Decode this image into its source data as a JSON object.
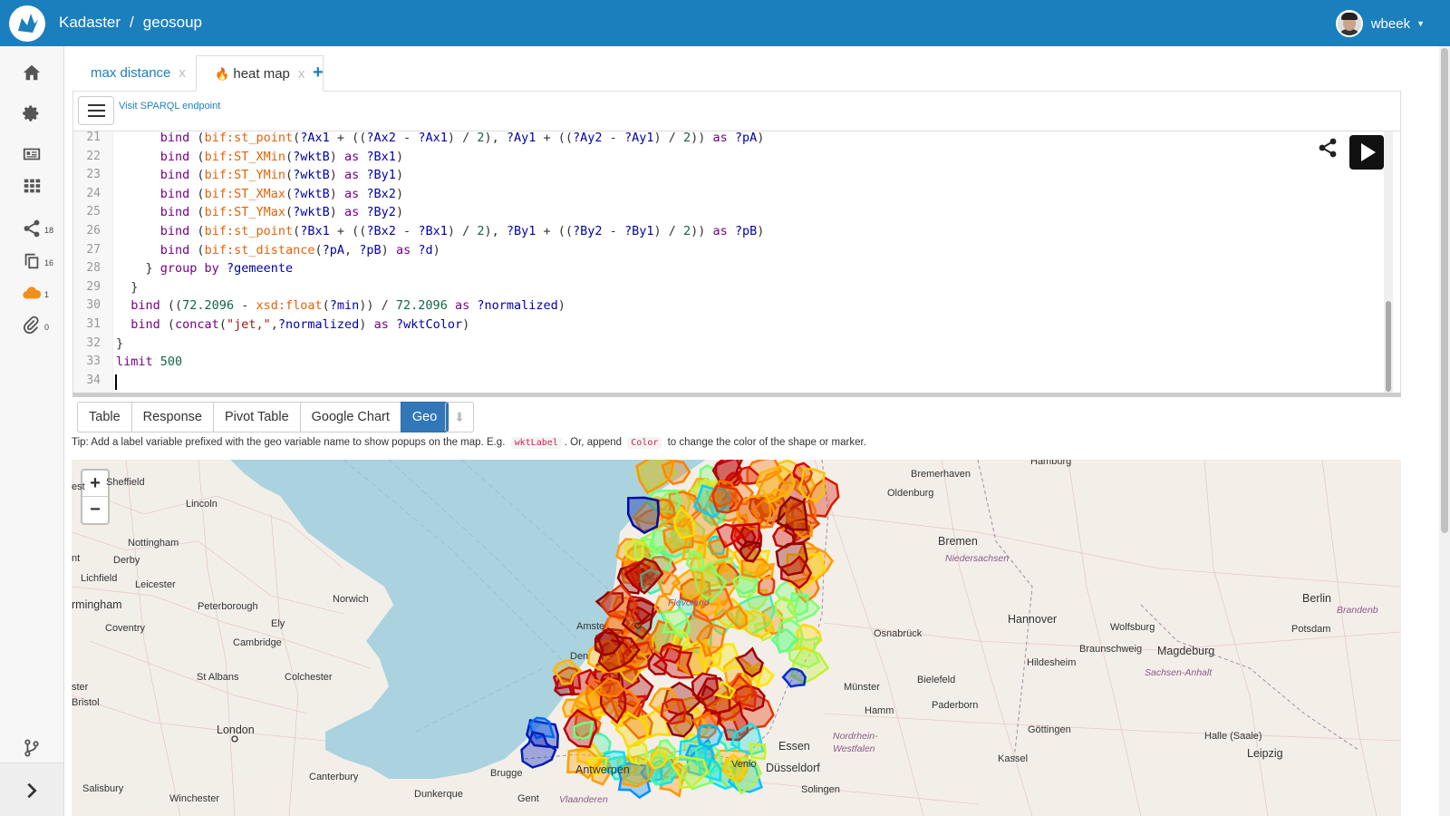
{
  "header": {
    "org": "Kadaster",
    "separator": "/",
    "dataset": "geosoup",
    "user": "wbeek",
    "brand_color": "#1c7fbd"
  },
  "sidebar": {
    "items": [
      {
        "icon": "home-icon"
      },
      {
        "icon": "gear-icon"
      },
      {
        "icon": "id-card-icon"
      },
      {
        "icon": "grid-icon"
      },
      {
        "icon": "share-icon",
        "count": "18"
      },
      {
        "icon": "copy-icon",
        "count": "16"
      },
      {
        "icon": "cloud-icon",
        "count": "1"
      },
      {
        "icon": "paperclip-icon",
        "count": "0"
      },
      {
        "icon": "branch-icon"
      }
    ],
    "expand_icon": "chevron-right-icon"
  },
  "tabs": [
    {
      "label": "max distance",
      "close": "x"
    },
    {
      "label": "heat map",
      "close": "x",
      "active": true
    }
  ],
  "editor": {
    "endpoint_link": "Visit SPARQL endpoint",
    "lines": [
      {
        "n": "21",
        "html": "      <span class='kw'>bind</span> (<span class='fn'>bif:st_point</span>(<span class='var'>?Ax1</span> + ((<span class='var'>?Ax2</span> - <span class='var'>?Ax1</span>) / <span class='num'>2</span>), <span class='var'>?Ay1</span> + ((<span class='var'>?Ay2</span> - <span class='var'>?Ay1</span>) / <span class='num'>2</span>)) <span class='kw'>as</span> <span class='var'>?pA</span>)"
      },
      {
        "n": "22",
        "html": "      <span class='kw'>bind</span> (<span class='fn'>bif:ST_XMin</span>(<span class='var'>?wktB</span>) <span class='kw'>as</span> <span class='var'>?Bx1</span>)"
      },
      {
        "n": "23",
        "html": "      <span class='kw'>bind</span> (<span class='fn'>bif:ST_YMin</span>(<span class='var'>?wktB</span>) <span class='kw'>as</span> <span class='var'>?By1</span>)"
      },
      {
        "n": "24",
        "html": "      <span class='kw'>bind</span> (<span class='fn'>bif:ST_XMax</span>(<span class='var'>?wktB</span>) <span class='kw'>as</span> <span class='var'>?Bx2</span>)"
      },
      {
        "n": "25",
        "html": "      <span class='kw'>bind</span> (<span class='fn'>bif:ST_YMax</span>(<span class='var'>?wktB</span>) <span class='kw'>as</span> <span class='var'>?By2</span>)"
      },
      {
        "n": "26",
        "html": "      <span class='kw'>bind</span> (<span class='fn'>bif:st_point</span>(<span class='var'>?Bx1</span> + ((<span class='var'>?Bx2</span> - <span class='var'>?Bx1</span>) / <span class='num'>2</span>), <span class='var'>?By1</span> + ((<span class='var'>?By2</span> - <span class='var'>?By1</span>) / <span class='num'>2</span>)) <span class='kw'>as</span> <span class='var'>?pB</span>)"
      },
      {
        "n": "27",
        "html": "      <span class='kw'>bind</span> (<span class='fn'>bif:st_distance</span>(<span class='var'>?pA</span>, <span class='var'>?pB</span>) <span class='kw'>as</span> <span class='var'>?d</span>)"
      },
      {
        "n": "28",
        "html": "    } <span class='kw'>group by</span> <span class='var'>?gemeente</span>"
      },
      {
        "n": "29",
        "html": "  }"
      },
      {
        "n": "30",
        "html": "  <span class='kw'>bind</span> ((<span class='num'>72.2096</span> - <span class='fn'>xsd:float</span>(<span class='var'>?min</span>)) / <span class='num'>72.2096</span> <span class='kw'>as</span> <span class='var'>?normalized</span>)"
      },
      {
        "n": "31",
        "html": "  <span class='kw'>bind</span> (<span class='kw'>concat</span>(<span class='str'>\"jet,\"</span>,<span class='var'>?normalized</span>) <span class='kw'>as</span> <span class='var'>?wktColor</span>)"
      },
      {
        "n": "32",
        "html": "}"
      },
      {
        "n": "33",
        "html": "<span class='kw'>limit</span> <span class='num'>500</span>"
      },
      {
        "n": "34",
        "html": ""
      }
    ]
  },
  "results": {
    "tabs": [
      "Table",
      "Response",
      "Pivot Table",
      "Google Chart",
      "Geo"
    ],
    "active": "Geo",
    "download_icon": "download-icon",
    "tip_prefix": "Tip: Add a label variable prefixed with the geo variable name to show popups on the map. E.g.",
    "tip_code1": "wktLabel",
    "tip_mid": ". Or, append",
    "tip_code2": "Color",
    "tip_suffix": "to change the color of the shape or marker."
  },
  "map": {
    "zoom_in": "+",
    "zoom_out": "−",
    "places": [
      {
        "name": "Sheffield",
        "l": 38,
        "t": 19
      },
      {
        "name": "est",
        "l": 0,
        "t": 24
      },
      {
        "name": "Lincoln",
        "l": 126,
        "t": 43
      },
      {
        "name": "Nottingham",
        "l": 62,
        "t": 86
      },
      {
        "name": "Derby",
        "l": 46,
        "t": 105
      },
      {
        "name": "nt",
        "l": 0,
        "t": 103
      },
      {
        "name": "Lichfield",
        "l": 10,
        "t": 125
      },
      {
        "name": "rmingham",
        "l": 0,
        "t": 153,
        "big": true
      },
      {
        "name": "Leicester",
        "l": 70,
        "t": 132
      },
      {
        "name": "Peterborough",
        "l": 139,
        "t": 156
      },
      {
        "name": "Norwich",
        "l": 288,
        "t": 148
      },
      {
        "name": "Coventry",
        "l": 37,
        "t": 180
      },
      {
        "name": "Ely",
        "l": 220,
        "t": 175
      },
      {
        "name": "Cambridge",
        "l": 178,
        "t": 196
      },
      {
        "name": "ster",
        "l": 0,
        "t": 245
      },
      {
        "name": "Bristol",
        "l": 0,
        "t": 262
      },
      {
        "name": "St Albans",
        "l": 138,
        "t": 234
      },
      {
        "name": "Colchester",
        "l": 235,
        "t": 234
      },
      {
        "name": "London",
        "l": 160,
        "t": 291,
        "big": true
      },
      {
        "name": "Canterbury",
        "l": 262,
        "t": 344
      },
      {
        "name": "Salisbury",
        "l": 12,
        "t": 357
      },
      {
        "name": "Winchester",
        "l": 108,
        "t": 368
      },
      {
        "name": "Dunkerque",
        "l": 378,
        "t": 363
      },
      {
        "name": "Brugge",
        "l": 462,
        "t": 340
      },
      {
        "name": "Antwerpen",
        "l": 556,
        "t": 335,
        "big": true
      },
      {
        "name": "Gent",
        "l": 492,
        "t": 368
      },
      {
        "name": "Amste",
        "l": 557,
        "t": 178
      },
      {
        "name": "Den",
        "l": 550,
        "t": 211
      },
      {
        "name": "Flevoland",
        "l": 658,
        "t": 152,
        "reg": true
      },
      {
        "name": "Bremerhaven",
        "l": 926,
        "t": 10
      },
      {
        "name": "Hamburg",
        "l": 1058,
        "t": -4
      },
      {
        "name": "Oldenburg",
        "l": 900,
        "t": 31
      },
      {
        "name": "Bremen",
        "l": 956,
        "t": 83,
        "big": true
      },
      {
        "name": "Niedersachsen",
        "l": 964,
        "t": 103,
        "reg": true
      },
      {
        "name": "Hannover",
        "l": 1033,
        "t": 169,
        "big": true
      },
      {
        "name": "Wolfsburg",
        "l": 1146,
        "t": 179
      },
      {
        "name": "Berlin",
        "l": 1358,
        "t": 146,
        "big": true
      },
      {
        "name": "Brandenb",
        "l": 1396,
        "t": 160,
        "reg": true
      },
      {
        "name": "Potsdam",
        "l": 1346,
        "t": 181
      },
      {
        "name": "Osnabrück",
        "l": 885,
        "t": 186
      },
      {
        "name": "Braunschweig",
        "l": 1112,
        "t": 203
      },
      {
        "name": "Magdeburg",
        "l": 1198,
        "t": 204,
        "big": true
      },
      {
        "name": "Hildesheim",
        "l": 1054,
        "t": 218
      },
      {
        "name": "Sachsen-Anhalt",
        "l": 1184,
        "t": 229,
        "reg": true
      },
      {
        "name": "Bielefeld",
        "l": 933,
        "t": 237
      },
      {
        "name": "Münster",
        "l": 852,
        "t": 245
      },
      {
        "name": "Hamm",
        "l": 875,
        "t": 271
      },
      {
        "name": "Paderborn",
        "l": 949,
        "t": 265
      },
      {
        "name": "Nordrhein-",
        "l": 840,
        "t": 299,
        "reg": true
      },
      {
        "name": "Westfalen",
        "l": 840,
        "t": 313,
        "reg": true
      },
      {
        "name": "Göttingen",
        "l": 1055,
        "t": 292
      },
      {
        "name": "Halle (Saale)",
        "l": 1250,
        "t": 299
      },
      {
        "name": "Essen",
        "l": 780,
        "t": 309,
        "big": true
      },
      {
        "name": "Kassel",
        "l": 1022,
        "t": 324
      },
      {
        "name": "Leipzig",
        "l": 1297,
        "t": 317,
        "big": true
      },
      {
        "name": "Düsseldorf",
        "l": 766,
        "t": 333,
        "big": true
      },
      {
        "name": "Venlo",
        "l": 728,
        "t": 330
      },
      {
        "name": "Solingen",
        "l": 805,
        "t": 358
      },
      {
        "name": "Vlaanderen",
        "l": 538,
        "t": 369,
        "reg": true
      }
    ]
  }
}
